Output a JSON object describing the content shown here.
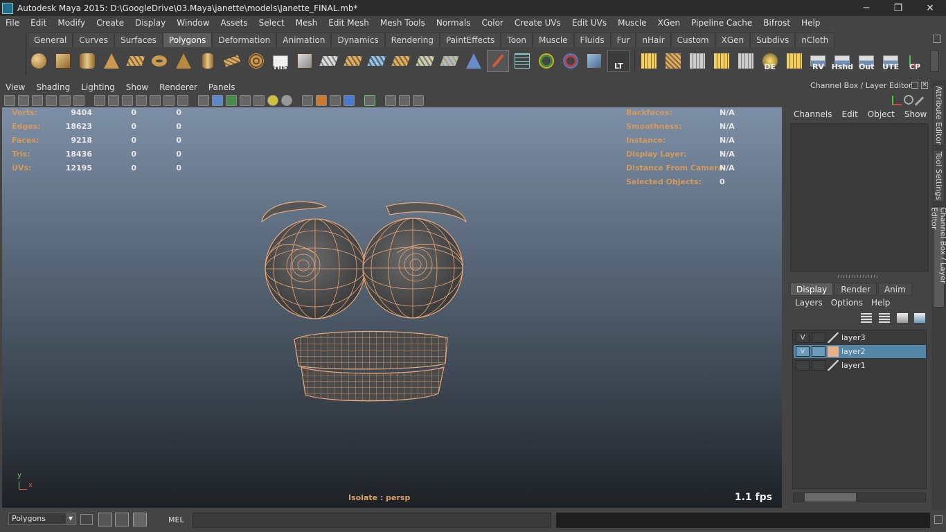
{
  "window": {
    "title": "Autodesk Maya 2015: D:\\GoogleDrive\\03.Maya\\janette\\models\\Janette_FINAL.mb*",
    "min": "─",
    "restore": "❐",
    "close": "✕"
  },
  "menubar": [
    "File",
    "Edit",
    "Modify",
    "Create",
    "Display",
    "Window",
    "Assets",
    "Select",
    "Mesh",
    "Edit Mesh",
    "Mesh Tools",
    "Normals",
    "Color",
    "Create UVs",
    "Edit UVs",
    "Muscle",
    "XGen",
    "Pipeline Cache",
    "Bifrost",
    "Help"
  ],
  "shelf": {
    "tabs": [
      "General",
      "Curves",
      "Surfaces",
      "Polygons",
      "Deformation",
      "Animation",
      "Dynamics",
      "Rendering",
      "PaintEffects",
      "Toon",
      "Muscle",
      "Fluids",
      "Fur",
      "nHair",
      "Custom",
      "XGen",
      "Subdivs",
      "nCloth"
    ],
    "active_tab": "Polygons",
    "labels": {
      "his": "His",
      "lt": "LT",
      "de": "DE",
      "rv": "RV",
      "hshd": "Hshd",
      "out": "Out",
      "ute": "UTE",
      "cp": "CP"
    }
  },
  "viewport": {
    "menu": [
      "View",
      "Shading",
      "Lighting",
      "Show",
      "Renderer",
      "Panels"
    ],
    "hud_left": [
      {
        "label": "Verts:",
        "v1": "9404",
        "v2": "0",
        "v3": "0"
      },
      {
        "label": "Edges:",
        "v1": "18623",
        "v2": "0",
        "v3": "0"
      },
      {
        "label": "Faces:",
        "v1": "9218",
        "v2": "0",
        "v3": "0"
      },
      {
        "label": "Tris:",
        "v1": "18436",
        "v2": "0",
        "v3": "0"
      },
      {
        "label": "UVs:",
        "v1": "12195",
        "v2": "0",
        "v3": "0"
      }
    ],
    "hud_right": [
      {
        "label": "Backfaces:",
        "value": "N/A"
      },
      {
        "label": "Smoothness:",
        "value": "N/A"
      },
      {
        "label": "Instance:",
        "value": "N/A"
      },
      {
        "label": "Display Layer:",
        "value": "N/A"
      },
      {
        "label": "Distance From Camera:",
        "value": "N/A"
      },
      {
        "label": "Selected Objects:",
        "value": "0"
      }
    ],
    "isolate": "Isolate : persp",
    "fps": "1.1 fps",
    "axis_y": "y",
    "axis_x": "x"
  },
  "channel_box": {
    "title": "Channel Box / Layer Editor",
    "menu": [
      "Channels",
      "Edit",
      "Object",
      "Show"
    ]
  },
  "layer_editor": {
    "tabs": [
      "Display",
      "Render",
      "Anim"
    ],
    "active_tab": "Display",
    "menu": [
      "Layers",
      "Options",
      "Help"
    ],
    "layers": [
      {
        "name": "layer3",
        "visible": "V",
        "color": null,
        "selected": false
      },
      {
        "name": "layer2",
        "visible": "V",
        "color": "#e8b088",
        "selected": true
      },
      {
        "name": "layer1",
        "visible": "",
        "color": null,
        "selected": false
      }
    ]
  },
  "side_tabs": [
    "Attribute Editor",
    "Tool Settings",
    "Channel Box / Layer Editor"
  ],
  "command": {
    "mode": "Polygons",
    "mel_label": "MEL"
  },
  "colors": {
    "wire": "#e8a878",
    "hud_label": "#d49a60",
    "selection": "#5285a6"
  }
}
